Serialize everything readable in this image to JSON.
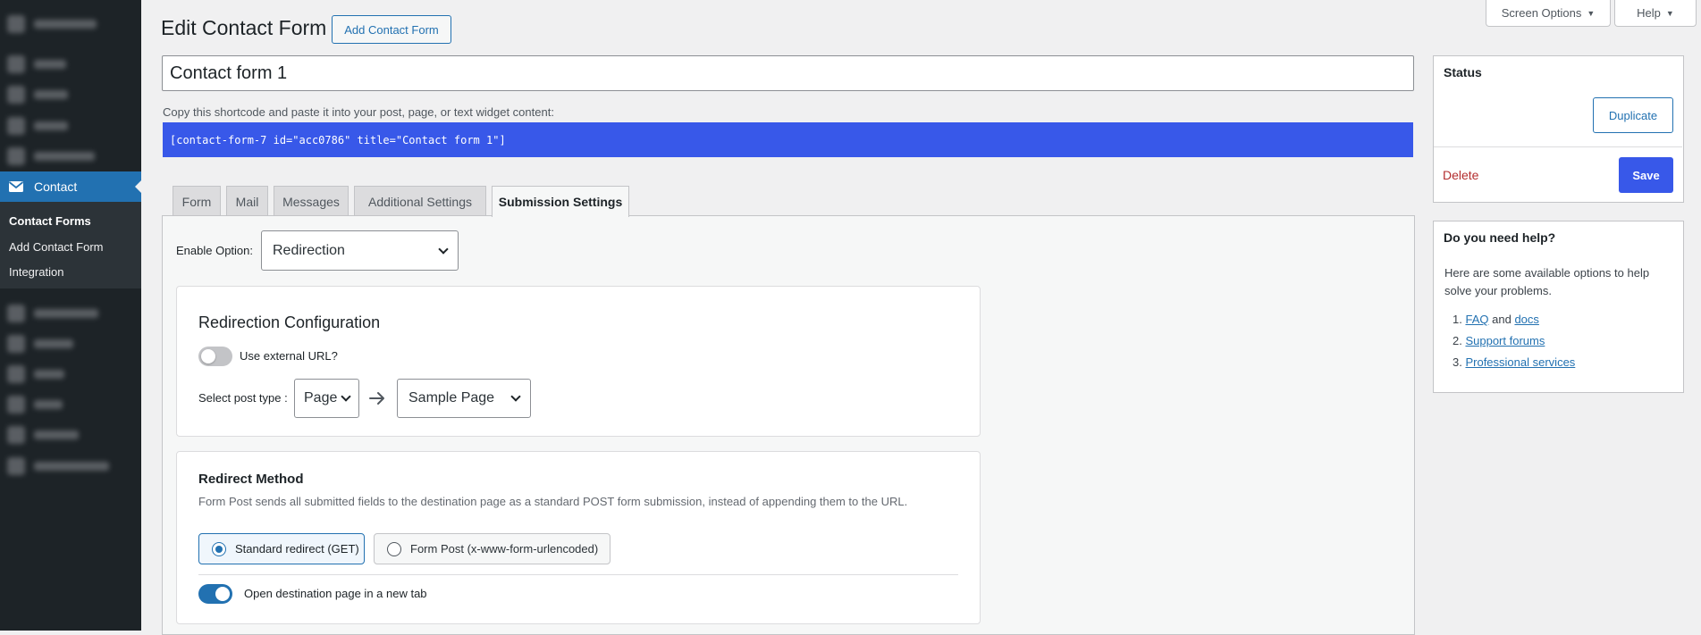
{
  "sidebar": {
    "contact_label": "Contact",
    "submenu": [
      {
        "label": "Contact Forms"
      },
      {
        "label": "Add Contact Form"
      },
      {
        "label": "Integration"
      }
    ]
  },
  "top": {
    "screen_options": "Screen Options",
    "help": "Help"
  },
  "header": {
    "title": "Edit Contact Form",
    "add_new": "Add Contact Form"
  },
  "form_title": "Contact form 1",
  "shortcode": {
    "label": "Copy this shortcode and paste it into your post, page, or text widget content:",
    "value": "[contact-form-7 id=\"acc0786\" title=\"Contact form 1\"]"
  },
  "tabs": [
    {
      "label": "Form"
    },
    {
      "label": "Mail"
    },
    {
      "label": "Messages"
    },
    {
      "label": "Additional Settings"
    },
    {
      "label": "Submission Settings"
    }
  ],
  "submission": {
    "enable_label": "Enable Option:",
    "enable_value": "Redirection",
    "redirection": {
      "title": "Redirection Configuration",
      "external_url_label": "Use external URL?",
      "external_url_enabled": false,
      "post_type_label": "Select post type :",
      "post_type_value": "Page",
      "page_value": "Sample Page"
    },
    "method": {
      "title": "Redirect Method",
      "description": "Form Post sends all submitted fields to the destination page as a standard POST form submission, instead of appending them to the URL.",
      "option_get": "Standard redirect (GET)",
      "option_post": "Form Post (x-www-form-urlencoded)",
      "selected": "get",
      "new_tab_label": "Open destination page in a new tab",
      "new_tab_enabled": true
    }
  },
  "status_box": {
    "title": "Status",
    "duplicate": "Duplicate",
    "delete": "Delete",
    "save": "Save"
  },
  "help_box": {
    "title": "Do you need help?",
    "intro": "Here are some available options to help solve your problems.",
    "item1_num": "1.",
    "item1_faq": "FAQ",
    "item1_and": "and",
    "item1_docs": "docs",
    "item2_num": "2.",
    "item2": "Support forums",
    "item3_num": "3.",
    "item3": "Professional services"
  },
  "colors": {
    "accent": "#2271b1",
    "shortcode_bg": "#3858e9",
    "delete": "#b32d2e",
    "sidebar_bg": "#1d2327"
  }
}
